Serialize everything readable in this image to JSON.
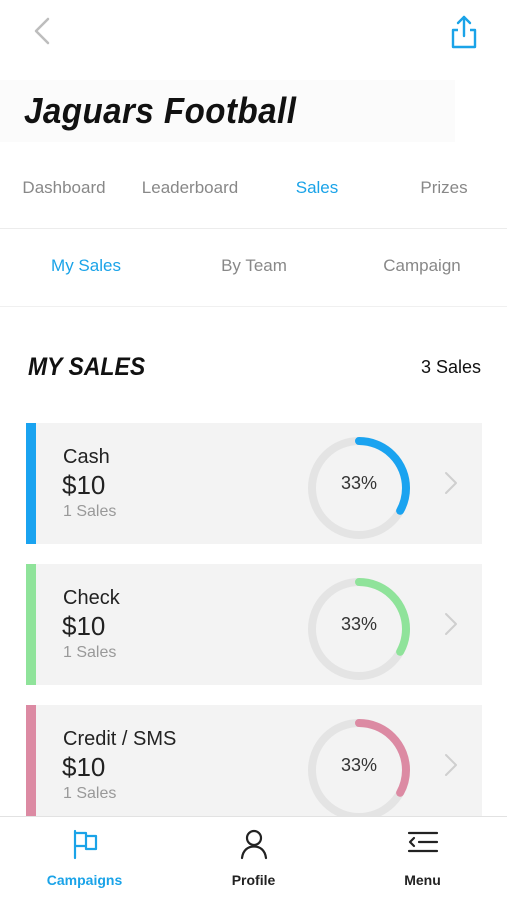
{
  "header": {
    "title": "Jaguars Football",
    "back_icon": "chevron-left-icon",
    "share_icon": "share-icon"
  },
  "main_tabs": [
    {
      "label": "Dashboard",
      "active": false
    },
    {
      "label": "Leaderboard",
      "active": false
    },
    {
      "label": "Sales",
      "active": true
    },
    {
      "label": "Prizes",
      "active": false
    }
  ],
  "sub_tabs": [
    {
      "label": "My Sales",
      "active": true
    },
    {
      "label": "By Team",
      "active": false
    },
    {
      "label": "Campaign",
      "active": false
    }
  ],
  "section": {
    "title": "MY SALES",
    "count": "3 Sales"
  },
  "cards": [
    {
      "name": "Cash",
      "amount": "$10",
      "count": "1 Sales",
      "percent_label": "33%",
      "percent": 33,
      "color": "#1aa3f0"
    },
    {
      "name": "Check",
      "amount": "$10",
      "count": "1 Sales",
      "percent_label": "33%",
      "percent": 33,
      "color": "#8fe39a"
    },
    {
      "name": "Credit / SMS",
      "amount": "$10",
      "count": "1 Sales",
      "percent_label": "33%",
      "percent": 33,
      "color": "#dc8aa3"
    }
  ],
  "bottom_nav": [
    {
      "label": "Campaigns",
      "icon": "flag-icon",
      "active": true
    },
    {
      "label": "Profile",
      "icon": "user-icon",
      "active": false
    },
    {
      "label": "Menu",
      "icon": "menu-icon",
      "active": false
    }
  ],
  "colors": {
    "accent": "#1aa3e8",
    "card_background": "#f3f3f3",
    "inactive_text": "#888888"
  }
}
